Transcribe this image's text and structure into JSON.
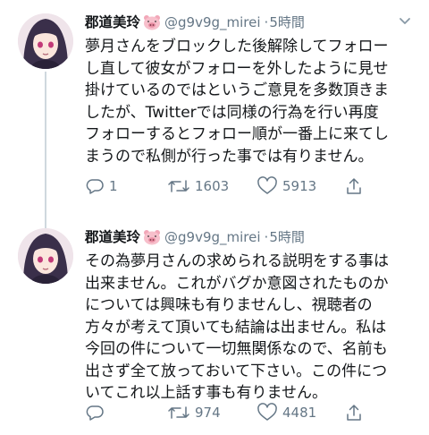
{
  "tweets": [
    {
      "display_name": "郡道美玲",
      "name_emoji": "pig-face-emoji",
      "handle": "@g9v9g_mirei",
      "separator": "·",
      "time": "5時間",
      "text": "夢月さんをブロックした後解除してフォロー\nし直して彼女がフォローを外したように見せ\n掛けているのではというご意見を多数頂きま\nしたが、Twitterでは同様の行為を行い再度\nフォローするとフォロー順が一番上に来てし\nまうので私側が行った事では有りません。",
      "reply_count": "1",
      "retweet_count": "1603",
      "like_count": "5913",
      "show_thread_line": true
    },
    {
      "display_name": "郡道美玲",
      "name_emoji": "pig-face-emoji",
      "handle": "@g9v9g_mirei",
      "separator": "·",
      "time": "5時間",
      "text": "その為夢月さんの求められる説明をする事は\n出来ません。これがバグか意図されたものか\nについては興味も有りませんし、視聴者の\n方々が考えて頂いても結論は出ません。私は\n今回の件について一切無関係なので、名前も\n出さず全て放っておいて下さい。この件につ\nいてこれ以上話す事も有りません。",
      "reply_count": "",
      "retweet_count": "974",
      "like_count": "4481",
      "show_thread_line": false
    }
  ],
  "colors": {
    "text": "#14171a",
    "secondary": "#657786",
    "thread_line": "#cfd8de"
  }
}
